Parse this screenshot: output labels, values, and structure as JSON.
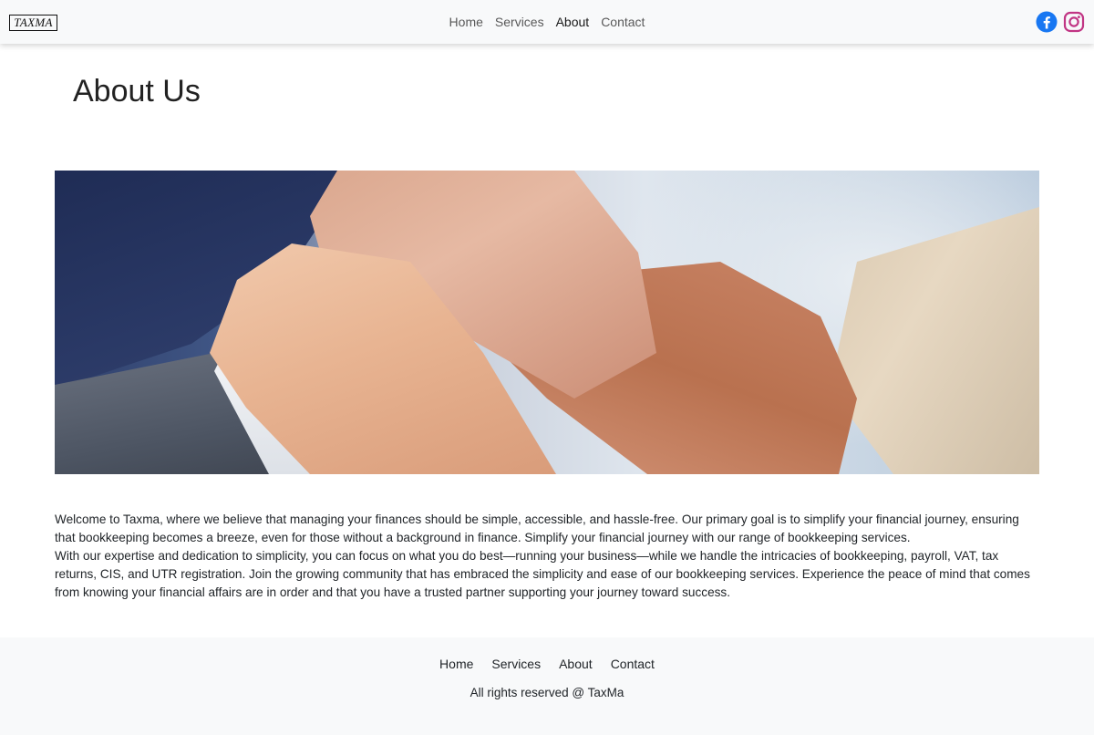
{
  "header": {
    "logo": "TAXMA",
    "nav": [
      {
        "label": "Home",
        "active": false
      },
      {
        "label": "Services",
        "active": false
      },
      {
        "label": "About",
        "active": true
      },
      {
        "label": "Contact",
        "active": false
      }
    ],
    "social_icons": [
      "facebook-icon",
      "instagram-icon"
    ]
  },
  "page": {
    "title": "About Us",
    "hero_image": "hands-joined-teamwork-photo",
    "paragraphs": [
      "Welcome to Taxma, where we believe that managing your finances should be simple, accessible, and hassle-free. Our primary goal is to simplify your financial journey, ensuring that bookkeeping becomes a breeze, even for those without a background in finance. Simplify your financial journey with our range of bookkeeping services.",
      "With our expertise and dedication to simplicity, you can focus on what you do best—running your business—while we handle the intricacies of bookkeeping, payroll, VAT, tax returns, CIS, and UTR registration. Join the growing community that has embraced the simplicity and ease of our bookkeeping services. Experience the peace of mind that comes from knowing your financial affairs are in order and that you have a trusted partner supporting your journey toward success."
    ]
  },
  "footer": {
    "links": [
      "Home",
      "Services",
      "About",
      "Contact"
    ],
    "copyright": "All rights reserved @ TaxMa"
  },
  "colors": {
    "facebook": "#1877f2",
    "instagram": "#c13584",
    "header_bg": "#f8f9fa",
    "footer_bg": "#f8f9fa"
  }
}
